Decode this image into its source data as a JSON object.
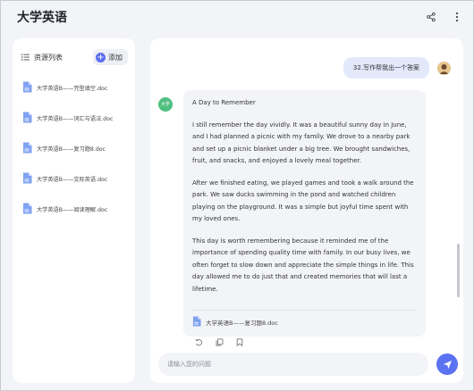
{
  "header": {
    "title": "大学英语",
    "share_icon": "share-icon",
    "more_icon": "more-vertical-icon"
  },
  "sidebar": {
    "title": "资源列表",
    "title_icon": "list-icon",
    "add_label": "添加",
    "items": [
      {
        "label": "大学英语B——完型填空.doc",
        "icon": "doc-icon"
      },
      {
        "label": "大学英语B——词汇与语法.doc",
        "icon": "doc-icon"
      },
      {
        "label": "大学英语B——复习题8.doc",
        "icon": "doc-icon"
      },
      {
        "label": "大学英语B——交际英语.doc",
        "icon": "doc-icon"
      },
      {
        "label": "大学英语B——阅读理解.doc",
        "icon": "doc-icon"
      }
    ]
  },
  "chat": {
    "user_message": "32.写作帮我出一个答案",
    "bot_avatar_label": "大学",
    "bot_message": {
      "title": "A Day to Remember",
      "paragraphs": [
        "I still remember the day vividly. It was a beautiful sunny day in June, and I had planned a picnic with my family. We drove to a nearby park and set up a picnic blanket under a big tree. We brought sandwiches, fruit, and snacks, and enjoyed a lovely meal together.",
        "After we finished eating, we played games and took a walk around the park. We saw ducks swimming in the pond and watched children playing on the playground. It was a simple but joyful time spent with my loved ones.",
        "This day is worth remembering because it reminded me of the importance of spending quality time with family. In our busy lives, we often forget to slow down and appreciate the simple things in life. This day allowed me to do just that and created memories that will last a lifetime."
      ],
      "attachment": "大学英语B——复习题8.doc"
    },
    "input_placeholder": "请输入您的问题",
    "send_icon": "send-icon"
  },
  "colors": {
    "accent": "#5b73f0",
    "user_bubble": "#e3e9fb",
    "bot_avatar": "#4fbf7f"
  }
}
